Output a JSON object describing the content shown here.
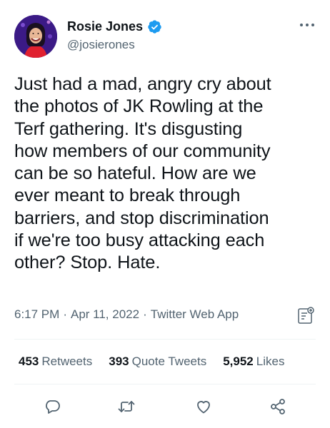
{
  "user": {
    "name": "Rosie Jones",
    "handle": "@josierones",
    "verified": true
  },
  "tweet": {
    "text": "Just had a mad, angry cry about\nthe photos of JK Rowling at the\nTerf gathering. It's disgusting\nhow members of our community\ncan be so hateful. How are we\never meant to break through\nbarriers, and stop discrimination\nif we're too busy attacking each\nother? Stop. Hate.",
    "time": "6:17 PM",
    "date": "Apr 11, 2022",
    "separator": "·",
    "source": "Twitter Web App"
  },
  "stats": {
    "retweets_count": "453",
    "retweets_label": "Retweets",
    "quotes_count": "393",
    "quotes_label": "Quote Tweets",
    "likes_count": "5,952",
    "likes_label": "Likes"
  },
  "icons": {
    "more": "more-options-icon",
    "verified": "verified-badge-icon",
    "analytics": "tweet-analytics-icon",
    "reply": "reply-icon",
    "retweet": "retweet-icon",
    "like": "like-icon",
    "share": "share-icon"
  },
  "colors": {
    "verified_blue": "#1d9bf0",
    "secondary_text": "#536471",
    "avatar_background": "#3b1a86",
    "shirt_red": "#e0202f"
  }
}
